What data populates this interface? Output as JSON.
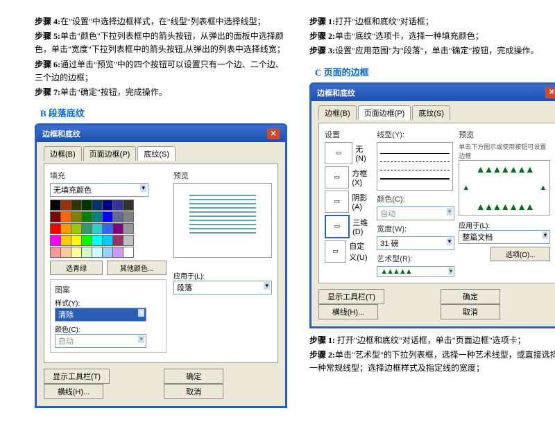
{
  "left": {
    "s4": "步骤 4:",
    "s4t": "在\"设置\"中选择边框样式，在\"线型\"列表框中选择线型；",
    "s5": "步骤 5:",
    "s5t": "单击\"颜色\"下拉列表框中的箭头按钮，从弹出的面板中选择颜色，单击\"宽度\"下拉列表框中的箭头按钮,从弹出的列表中选择线宽；",
    "s6": "步骤 6:",
    "s6t": "通过单击\"预览\"中的四个按钮可以设置只有一个边、二个边、三个边的边框；",
    "s7": "步骤 7:",
    "s7t": "单击\"确定\"按钮，完成操作。",
    "titleB": "B 段落底纹"
  },
  "right": {
    "s1": "步骤 1:",
    "s1t": "打开\"边框和底纹\"对话框；",
    "s2": "步骤 2:",
    "s2t": "单击\"底纹\"选项卡，选择一种填充颜色；",
    "s3": "步骤 3:",
    "s3t": "设置\"应用范围\"为\"段落\"，单击\"确定\"按钮，完成操作。",
    "titleC": "C 页面的边框",
    "b1": "步骤 1:",
    "b1t": " 打开\"边框和底纹\"对话框，单击\"页面边框\"选项卡；",
    "b2": "步骤 2:",
    "b2t": "单击\"艺术型\"的下拉列表框，选择一种艺术线型，或直接选择一种常规线型；选择边框样式及指定线的宽度；"
  },
  "dlg": {
    "title": "边框和底纹",
    "tabs": {
      "border": "边框(B)",
      "page": "页面边框(P)",
      "shading": "底纹(S)"
    },
    "fill": "填充",
    "noFill": "无填充颜色",
    "other": "其他颜色...",
    "more": "选青绿",
    "pattern": "图案",
    "style": "样式(Y):",
    "clear": "清除",
    "color": "颜色(C):",
    "auto": "自动",
    "preview": "预览",
    "previewHint": "单击下方图示或使用按钮可设置边框",
    "applyTo": "应用于(L):",
    "para": "段落",
    "wholeDoc": "整篇文档",
    "toolbar": "显示工具栏(T)",
    "hline": "横线(H)...",
    "ok": "确定",
    "cancel": "取消",
    "options": "选项(O)...",
    "setting": "设置",
    "none": "无(N)",
    "box": "方框(X)",
    "shadow": "阴影(A)",
    "threeD": "三维(D)",
    "custom": "自定义(U)",
    "lineType": "线型(Y):",
    "width": "宽度(W):",
    "widthVal": "31 磅",
    "art": "艺术型(R):"
  },
  "colors": [
    "#000",
    "#993300",
    "#333300",
    "#003300",
    "#003366",
    "#000080",
    "#333399",
    "#333",
    "#800000",
    "#f60",
    "#808000",
    "#008000",
    "#008080",
    "#00f",
    "#666699",
    "#808080",
    "#f00",
    "#ff9900",
    "#99cc00",
    "#339966",
    "#3cc",
    "#3366ff",
    "#800080",
    "#969696",
    "#f0f",
    "#fc0",
    "#ff0",
    "#0f0",
    "#0ff",
    "#0cf",
    "#993366",
    "#c0c0c0",
    "#f99",
    "#ffcc99",
    "#ffff99",
    "#cfc",
    "#cff",
    "#9cf",
    "#c9f",
    "#fff"
  ]
}
